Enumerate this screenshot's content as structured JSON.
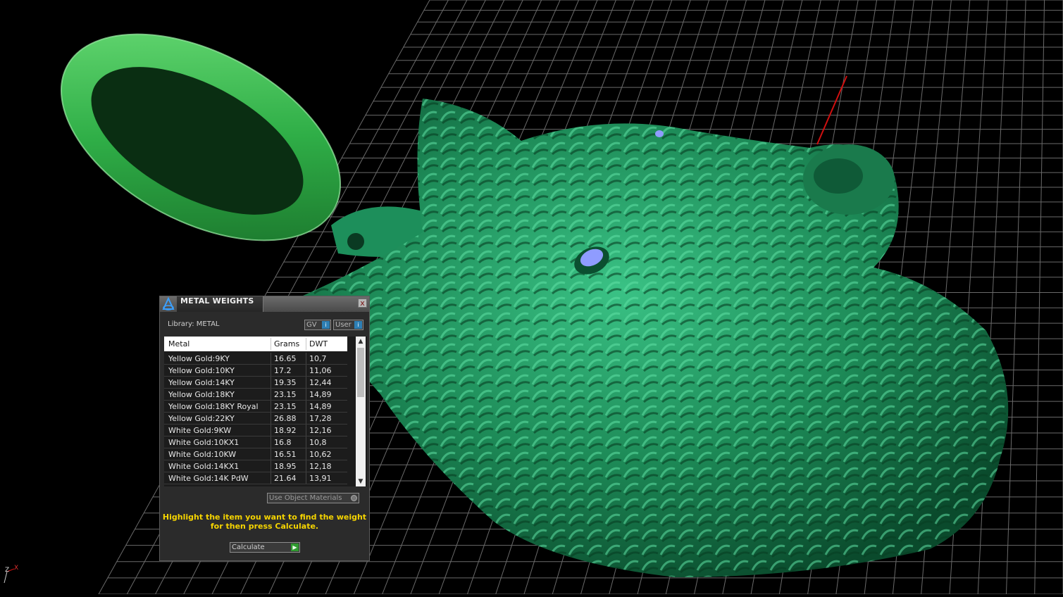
{
  "dialog": {
    "title": "METAL WEIGHTS",
    "close_glyph": "x",
    "library_label": "Library: METAL",
    "toggle_gv": "GV",
    "toggle_user": "User",
    "columns": [
      "Metal",
      "Grams",
      "DWT"
    ],
    "rows": [
      {
        "metal": "Yellow Gold:9KY",
        "grams": "16.65",
        "dwt": "10,7"
      },
      {
        "metal": "Yellow Gold:10KY",
        "grams": "17.2",
        "dwt": "11,06"
      },
      {
        "metal": "Yellow Gold:14KY",
        "grams": "19.35",
        "dwt": "12,44"
      },
      {
        "metal": "Yellow Gold:18KY",
        "grams": "23.15",
        "dwt": "14,89"
      },
      {
        "metal": "Yellow Gold:18KY Royal",
        "grams": "23.15",
        "dwt": "14,89"
      },
      {
        "metal": "Yellow Gold:22KY",
        "grams": "26.88",
        "dwt": "17,28"
      },
      {
        "metal": "White Gold:9KW",
        "grams": "18.92",
        "dwt": "12,16"
      },
      {
        "metal": "White Gold:10KX1",
        "grams": "16.8",
        "dwt": "10,8"
      },
      {
        "metal": "White Gold:10KW",
        "grams": "16.51",
        "dwt": "10,62"
      },
      {
        "metal": "White Gold:14KX1",
        "grams": "18.95",
        "dwt": "12,18"
      },
      {
        "metal": "White Gold:14K PdW",
        "grams": "21.64",
        "dwt": "13,91"
      }
    ],
    "use_object_materials": "Use Object Materials",
    "hint_line1": "Highlight the item you want to find the weight",
    "hint_line2": "for then press Calculate.",
    "calculate": "Calculate"
  },
  "axes": {
    "z": "Z",
    "x": "X"
  },
  "colors": {
    "model_green": "#1f8a5a",
    "ring_green": "#2fae47",
    "grid": "#8a8a8a",
    "axis_red": "#d01010",
    "hint_yellow": "#f5d400",
    "gem_blue": "#8f9cff"
  }
}
